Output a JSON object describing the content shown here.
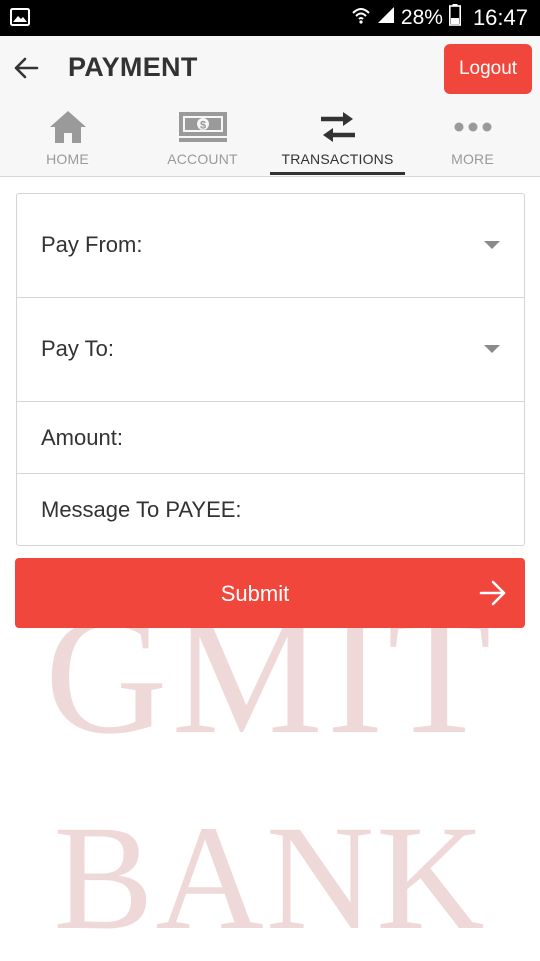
{
  "status_bar": {
    "battery": "28%",
    "time": "16:47",
    "icons": [
      "image-icon",
      "wifi-icon",
      "signal-icon",
      "battery-icon"
    ]
  },
  "header": {
    "title": "PAYMENT",
    "back_icon": "arrow-left-icon",
    "logout_label": "Logout"
  },
  "tabs": [
    {
      "label": "HOME",
      "icon": "home-icon",
      "active": false
    },
    {
      "label": "ACCOUNT",
      "icon": "money-icon",
      "active": false
    },
    {
      "label": "TRANSACTIONS",
      "icon": "swap-arrows-icon",
      "active": true
    },
    {
      "label": "MORE",
      "icon": "more-dots-icon",
      "active": false
    }
  ],
  "form": {
    "pay_from_label": "Pay From:",
    "pay_to_label": "Pay To:",
    "amount_label": "Amount:",
    "message_label": "Message To PAYEE:"
  },
  "submit": {
    "label": "Submit",
    "icon": "arrow-right-icon"
  },
  "watermark": {
    "line1": "GMIT",
    "line2": "BANK"
  },
  "colors": {
    "accent": "#f1463b",
    "header_bg": "#f7f7f7",
    "watermark": "#efd8d8"
  }
}
